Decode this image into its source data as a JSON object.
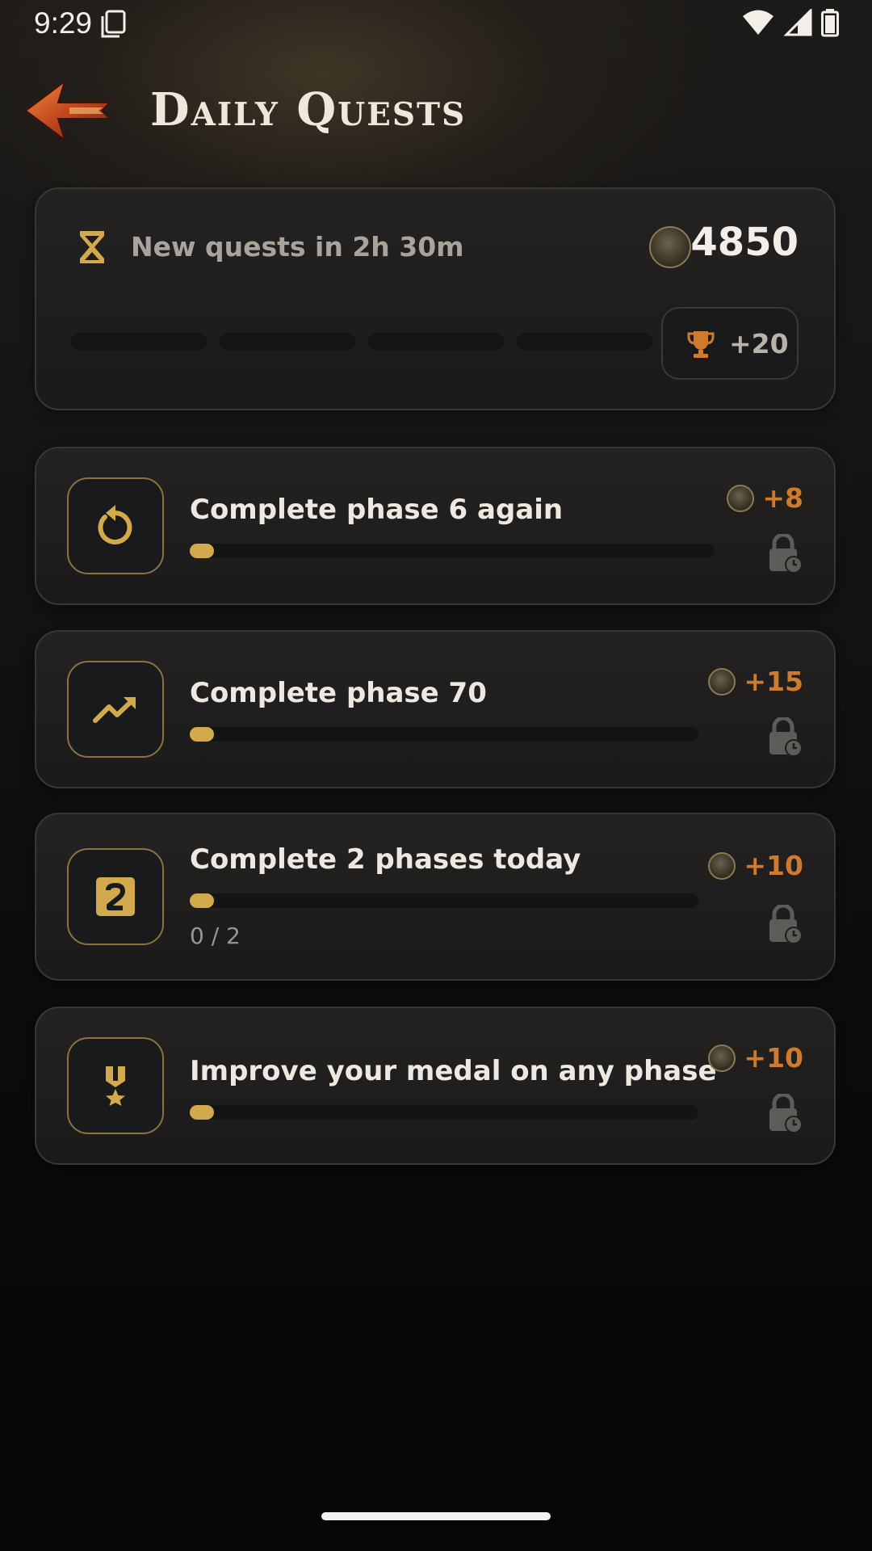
{
  "status_bar": {
    "time": "9:29"
  },
  "header": {
    "title": "Daily Quests"
  },
  "summary": {
    "refresh_text": "New quests in 2h 30m",
    "balance": "4850",
    "segments_completed": 0,
    "segments_total": 4,
    "bonus_reward": "+20"
  },
  "quests": [
    {
      "title": "Complete phase 6 again",
      "reward": "+8",
      "icon": "replay-icon",
      "progress": 0,
      "progress_text": ""
    },
    {
      "title": "Complete phase 70",
      "reward": "+15",
      "icon": "trending-up-icon",
      "progress": 0,
      "progress_text": ""
    },
    {
      "title": "Complete 2 phases today",
      "reward": "+10",
      "icon": "number-2-icon",
      "progress": 0,
      "progress_text": "0 / 2"
    },
    {
      "title": "Improve your medal on any phase",
      "reward": "+10",
      "icon": "medal-icon",
      "progress": 0,
      "progress_text": ""
    }
  ],
  "colors": {
    "accent_gold": "#d2a94c",
    "reward_orange": "#d07a2e",
    "icon_border": "#8a733e"
  }
}
